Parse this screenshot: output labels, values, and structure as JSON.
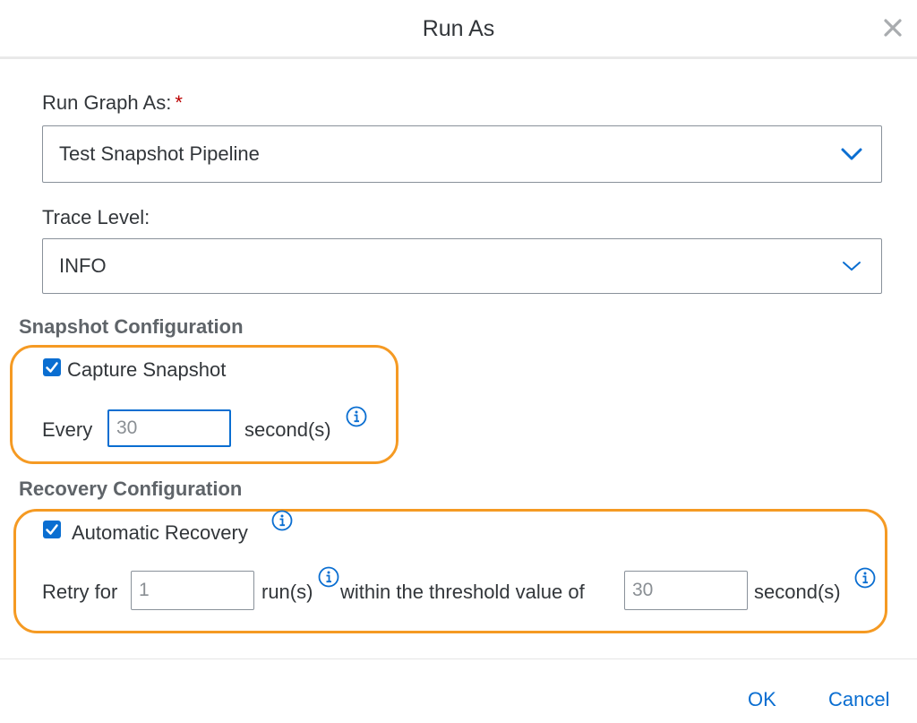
{
  "dialog": {
    "title": "Run As"
  },
  "run_graph": {
    "label": "Run Graph As:",
    "required_mark": "*",
    "selected": "Test Snapshot Pipeline"
  },
  "trace_level": {
    "label": "Trace Level:",
    "selected": "INFO"
  },
  "snapshot": {
    "section_title": "Snapshot Configuration",
    "capture_label": "Capture Snapshot",
    "capture_checked": true,
    "every_label": "Every",
    "interval_value": "30",
    "unit_label": "second(s)"
  },
  "recovery": {
    "section_title": "Recovery Configuration",
    "auto_label": "Automatic Recovery",
    "auto_checked": true,
    "retry_label": "Retry for",
    "runs_value": "1",
    "runs_unit": "run(s)",
    "threshold_label": "within the threshold value of",
    "threshold_value": "30",
    "threshold_unit": "second(s)"
  },
  "footer": {
    "ok_label": "OK",
    "cancel_label": "Cancel"
  },
  "colors": {
    "accent": "#0a6ed1",
    "highlight": "#f59a23",
    "required": "#bb0000"
  }
}
